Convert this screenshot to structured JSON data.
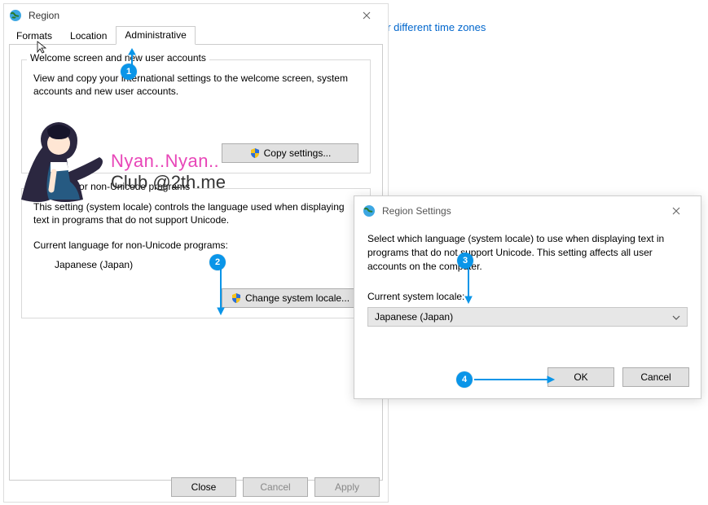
{
  "bg": {
    "link_fragment": "or different time zones"
  },
  "region": {
    "title": "Region",
    "tabs": [
      "Formats",
      "Location",
      "Administrative"
    ],
    "group1": {
      "legend": "Welcome screen and new user accounts",
      "text": "View and copy your international settings to the welcome screen, system accounts and new user accounts.",
      "button": "Copy settings..."
    },
    "group2": {
      "legend": "Language for non-Unicode programs",
      "text": "This setting (system locale) controls the language used when displaying text in programs that do not support Unicode.",
      "label": "Current language for non-Unicode programs:",
      "value": "Japanese (Japan)",
      "button": "Change system locale..."
    },
    "buttons": {
      "close": "Close",
      "cancel": "Cancel",
      "apply": "Apply"
    },
    "overlay": {
      "line1": "Nyan..Nyan..",
      "line2": "Club @2th.me"
    }
  },
  "settings": {
    "title": "Region Settings",
    "body": "Select which language (system locale) to use when displaying text in programs that do not support Unicode. This setting affects all user accounts on the computer.",
    "label": "Current system locale:",
    "value": "Japanese (Japan)",
    "ok": "OK",
    "cancel": "Cancel"
  },
  "steps": {
    "s1": "1",
    "s2": "2",
    "s3": "3",
    "s4": "4"
  }
}
